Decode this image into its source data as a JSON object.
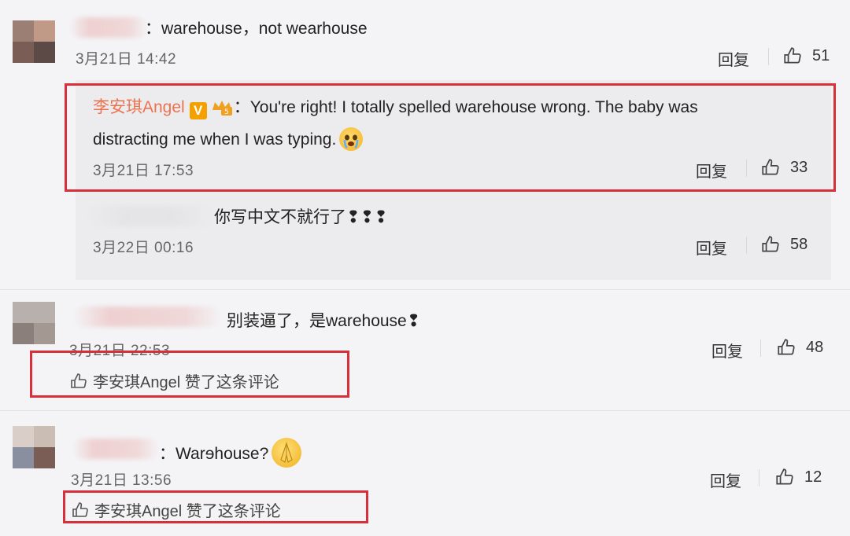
{
  "comments": [
    {
      "text": "：warehouse，not wearhouse",
      "time": "3月21日 14:42",
      "reply_label": "回复",
      "likes": "51"
    },
    {
      "author": "李安琪Angel",
      "text_line1": "：You're right! I totally spelled warehouse wrong. The baby was",
      "text_line2": "distracting me when I was typing.",
      "time": "3月21日 17:53",
      "reply_label": "回复",
      "likes": "33",
      "emoji": "crying-face"
    },
    {
      "text": "你写中文不就行了❢❢❢",
      "time": "3月22日 00:16",
      "reply_label": "回复",
      "likes": "58"
    },
    {
      "text": "别装逼了，是warehouse❢",
      "time": "3月21日 22:53",
      "reply_label": "回复",
      "likes": "48",
      "liked_by": "李安琪Angel 赞了这条评论"
    },
    {
      "text": "：Warɘhouse?",
      "time": "3月21日 13:56",
      "reply_label": "回复",
      "likes": "12",
      "liked_by": "李安琪Angel 赞了这条评论",
      "emoji": "praying-hands"
    }
  ],
  "colors": {
    "highlight_box": "#d7303a",
    "author_name": "#eb7350",
    "verified_badge": "#f4a000",
    "background": "#f4f4f6"
  }
}
